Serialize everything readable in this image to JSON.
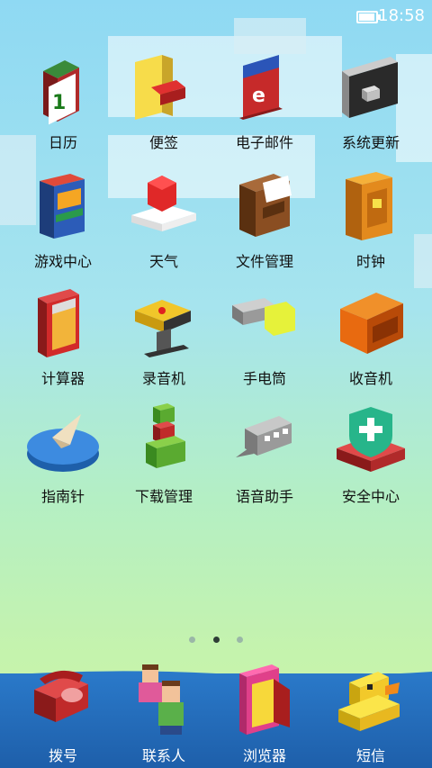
{
  "status_bar": {
    "time": "18:58"
  },
  "apps": [
    {
      "label": "日历",
      "icon": "calendar-icon"
    },
    {
      "label": "便签",
      "icon": "notes-icon"
    },
    {
      "label": "电子邮件",
      "icon": "email-icon"
    },
    {
      "label": "系统更新",
      "icon": "system-update-icon"
    },
    {
      "label": "游戏中心",
      "icon": "game-center-icon"
    },
    {
      "label": "天气",
      "icon": "weather-icon"
    },
    {
      "label": "文件管理",
      "icon": "file-manager-icon"
    },
    {
      "label": "时钟",
      "icon": "clock-icon"
    },
    {
      "label": "计算器",
      "icon": "calculator-icon"
    },
    {
      "label": "录音机",
      "icon": "recorder-icon"
    },
    {
      "label": "手电筒",
      "icon": "flashlight-icon"
    },
    {
      "label": "收音机",
      "icon": "radio-icon"
    },
    {
      "label": "指南针",
      "icon": "compass-icon"
    },
    {
      "label": "下载管理",
      "icon": "download-manager-icon"
    },
    {
      "label": "语音助手",
      "icon": "voice-assistant-icon"
    },
    {
      "label": "安全中心",
      "icon": "security-center-icon"
    }
  ],
  "calendar_day": "1",
  "page_indicator": {
    "pages": 3,
    "active": 2
  },
  "dock": [
    {
      "label": "拨号",
      "icon": "phone-icon"
    },
    {
      "label": "联系人",
      "icon": "contacts-icon"
    },
    {
      "label": "浏览器",
      "icon": "browser-icon"
    },
    {
      "label": "短信",
      "icon": "messages-icon"
    }
  ]
}
